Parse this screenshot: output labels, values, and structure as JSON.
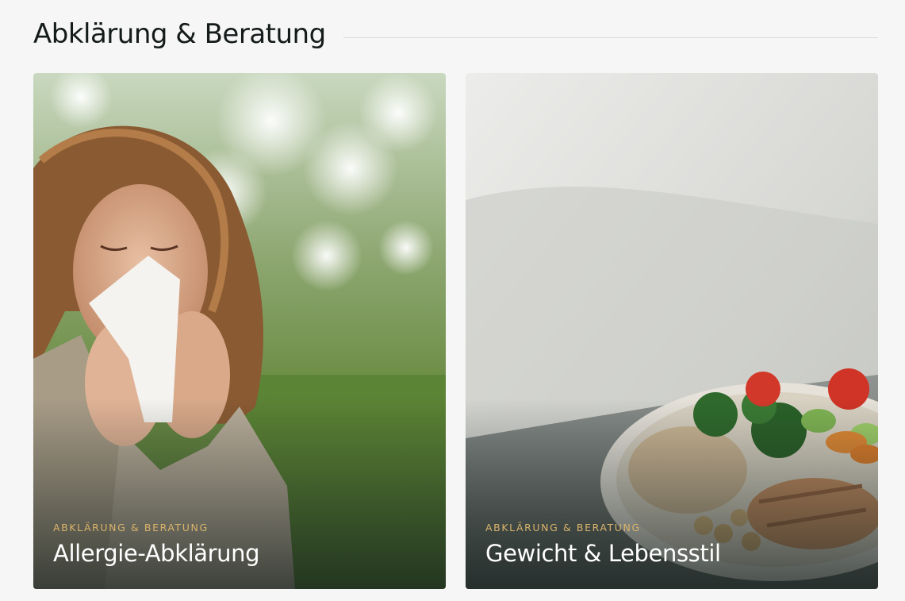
{
  "section": {
    "title": "Abklärung & Beratung"
  },
  "cards": [
    {
      "eyebrow": "ABKLÄRUNG & BERATUNG",
      "title": "Allergie-Abklärung",
      "image_subject": "woman-sneezing-in-blossoming-garden"
    },
    {
      "eyebrow": "ABKLÄRUNG & BERATUNG",
      "title": "Gewicht & Lebensstil",
      "image_subject": "bowl-of-quinoa-chicken-and-vegetables"
    }
  ],
  "colors": {
    "page_background": "#f5f6f5",
    "title_text": "#141b1a",
    "eyebrow_accent": "#d9b36a",
    "card_title": "#ffffff",
    "rule": "#d5dbdb"
  }
}
